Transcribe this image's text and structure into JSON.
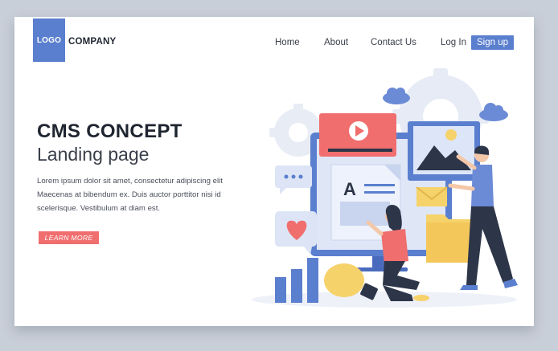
{
  "header": {
    "logo_label": "LOGO",
    "company_label": "COMPANY",
    "nav": {
      "home": "Home",
      "about": "About",
      "contact": "Contact Us",
      "login": "Log In",
      "signup": "Sign up"
    }
  },
  "hero": {
    "title": "CMS CONCEPT",
    "subtitle": "Landing page",
    "body_lines": [
      "Lorem ipsum dolor sit amet, consectetur adipiscing elit",
      "Maecenas at bibendum ex. Duis auctor porttitor nisi id",
      "scelerisque. Vestibulum at diam est."
    ],
    "cta_label": "LEARN MORE"
  },
  "illustration": {
    "icons": [
      "gear-icon",
      "cloud-icon",
      "video-play-icon",
      "image-icon",
      "text-document-icon",
      "chat-bubble-icon",
      "heart-icon",
      "envelope-icon",
      "folder-icon",
      "bar-chart-icon",
      "lightbulb-icon"
    ],
    "glyph_letter": "A"
  },
  "colors": {
    "accent_blue": "#5b7fcf",
    "accent_red": "#f06e6e",
    "background": "#c9cfd8",
    "card": "#ffffff",
    "dark_text": "#1f2530"
  }
}
